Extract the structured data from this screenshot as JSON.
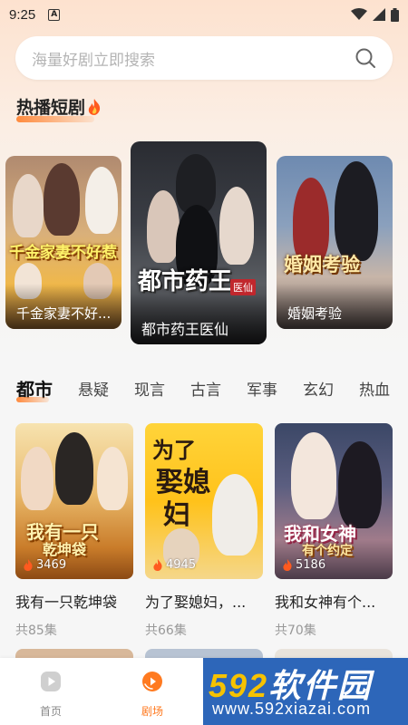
{
  "status_bar": {
    "time": "9:25",
    "notification_badge": "A"
  },
  "search": {
    "placeholder": "海量好剧立即搜索"
  },
  "hot_section": {
    "title": "热播短剧",
    "cards": [
      {
        "caption": "千金家妻不好..."
      },
      {
        "caption": "都市药王医仙"
      },
      {
        "caption": "婚姻考验"
      }
    ]
  },
  "categories": {
    "tabs": [
      "都市",
      "悬疑",
      "现言",
      "古言",
      "军事",
      "玄幻",
      "热血"
    ],
    "active_index": 0
  },
  "grid": [
    {
      "title": "我有一只乾坤袋",
      "views": "3469",
      "episodes": "共85集"
    },
    {
      "title": "为了娶媳妇，...",
      "views": "4945",
      "episodes": "共66集"
    },
    {
      "title": "我和女神有个...",
      "views": "5186",
      "episodes": "共70集"
    }
  ],
  "bottom_nav": {
    "items": [
      {
        "label": "首页",
        "icon": "play-circle-icon",
        "active": false
      },
      {
        "label": "剧场",
        "icon": "theater-play-icon",
        "active": true
      }
    ]
  },
  "watermark": {
    "brand_digits": "592",
    "brand_text": "软件园",
    "url": "www.592xiazai.com"
  },
  "colors": {
    "accent": "#ff7a20",
    "watermark_bg": "#2d66b9",
    "watermark_yellow": "#f6c200"
  }
}
